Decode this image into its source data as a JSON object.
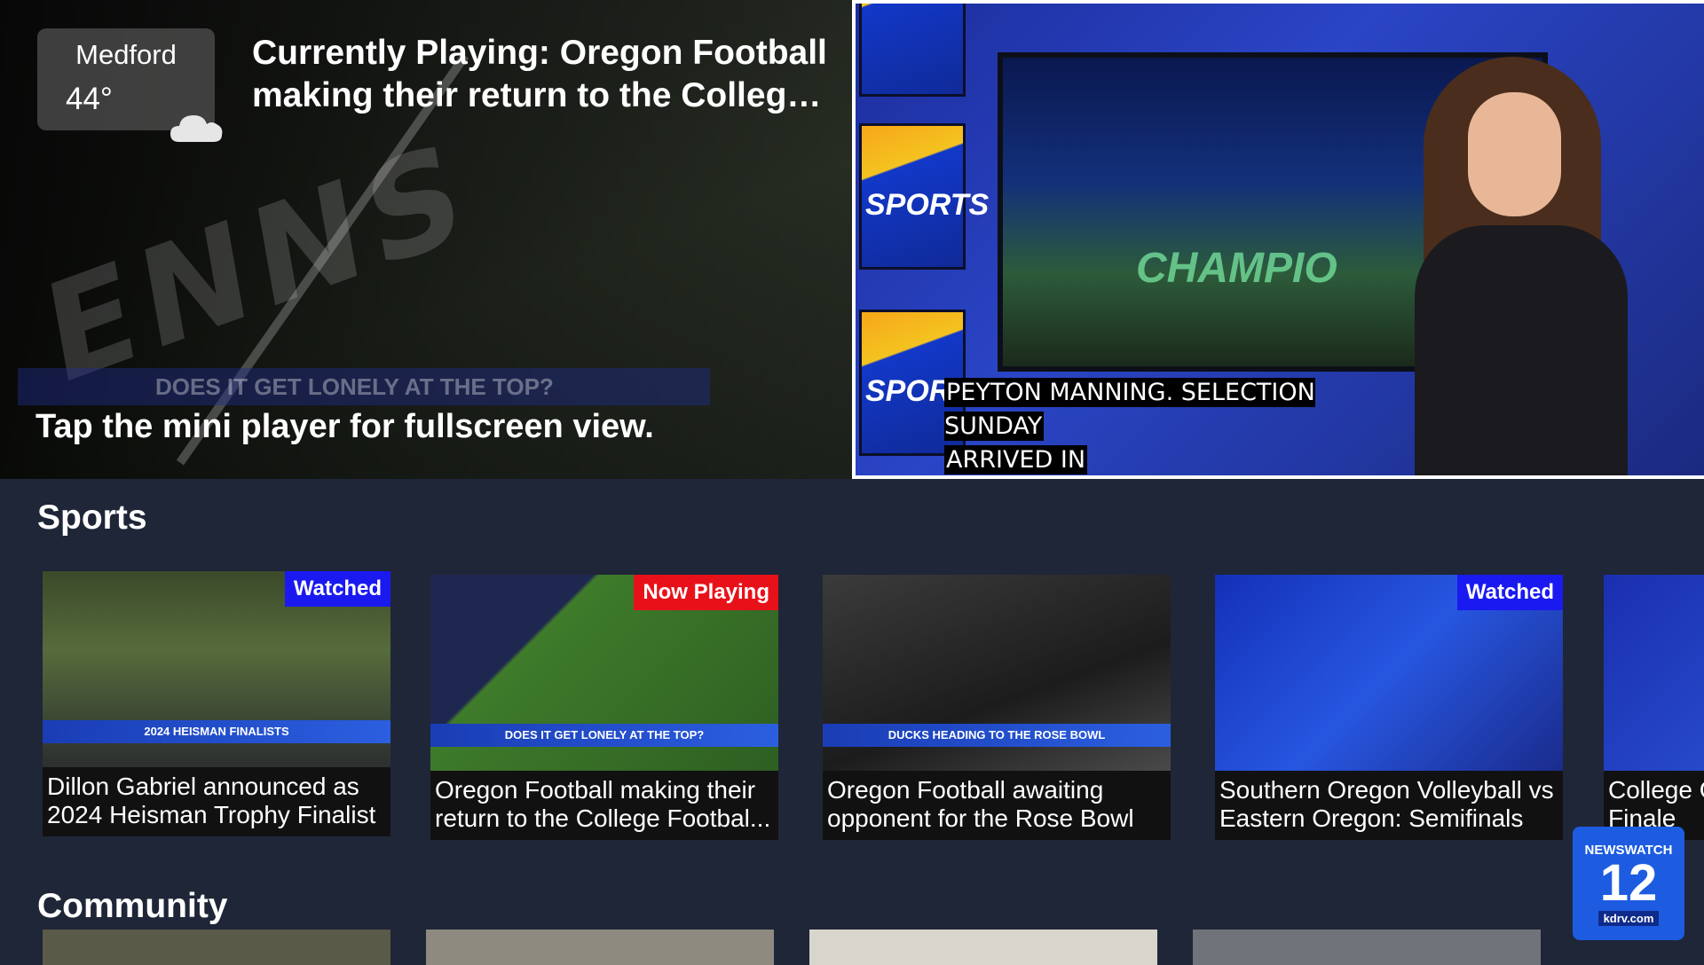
{
  "weather": {
    "city": "Medford",
    "temp": "44°",
    "icon": "cloud-icon"
  },
  "now_playing": {
    "line1": "Currently Playing: Oregon Football",
    "line2": "making their return to the College ..."
  },
  "hint": "Tap the mini player for fullscreen view.",
  "hero_overlay": {
    "endzone_text": "ENNS",
    "banner_text": "DOES IT GET LONELY AT THE TOP?"
  },
  "mini_player": {
    "caption_line1": "PEYTON MANNING. SELECTION SUNDAY",
    "caption_line2": "ARRIVED IN",
    "side_screen_text": "SPORTS",
    "monitor_text": "CHAMPIO"
  },
  "sections": {
    "sports": "Sports",
    "community": "Community"
  },
  "sports_cards": [
    {
      "badge": "Watched",
      "badge_type": "watched",
      "lower_third": "2024 HEISMAN FINALISTS",
      "line1": "Dillon Gabriel announced as",
      "line2": "2024 Heisman Trophy Finalist"
    },
    {
      "badge": "Now Playing",
      "badge_type": "playing",
      "lower_third": "DOES IT GET LONELY AT THE TOP?",
      "line1": "Oregon Football making their",
      "line2": "return to the College Footbal..."
    },
    {
      "badge": "",
      "badge_type": "",
      "lower_third": "DUCKS HEADING TO THE ROSE BOWL",
      "line1": "Oregon Football awaiting",
      "line2": "opponent for the Rose Bowl"
    },
    {
      "badge": "Watched",
      "badge_type": "watched",
      "lower_third": "",
      "line1": "Southern Oregon Volleyball vs",
      "line2": "Eastern Oregon: Semifinals"
    },
    {
      "badge": "",
      "badge_type": "",
      "lower_third": "",
      "line1": "College G",
      "line2": "Finale"
    }
  ],
  "logo": {
    "network": "NEWSWATCH",
    "number": "12",
    "site": "kdrv.com"
  },
  "colors": {
    "background": "#1f2637",
    "badge_watched": "#1a1af0",
    "badge_playing": "#e8111a",
    "logo_blue": "#1d5ce0"
  }
}
